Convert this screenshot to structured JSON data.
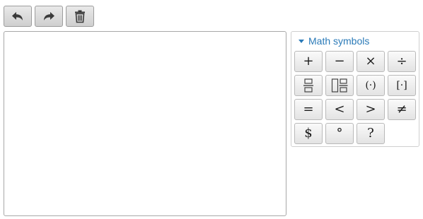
{
  "toolbar": {
    "buttons": [
      {
        "name": "undo-button",
        "icon": "undo-icon"
      },
      {
        "name": "redo-button",
        "icon": "redo-icon"
      },
      {
        "name": "delete-button",
        "icon": "trash-icon"
      }
    ]
  },
  "panel": {
    "title": "Math symbols",
    "symbols": {
      "plus": "+",
      "minus": "−",
      "times": "×",
      "divide": "÷",
      "fraction": "fraction-icon",
      "mixed_number": "mixed-number-icon",
      "parentheses": "(·)",
      "brackets": "[·]",
      "equals": "=",
      "less_than": "<",
      "greater_than": ">",
      "not_equal": "≠",
      "dollar": "$",
      "degree": "°",
      "question": "?"
    }
  },
  "colors": {
    "accent": "#2a7ab8",
    "button_top": "#e9e9e9",
    "button_bottom": "#cfcfcf"
  }
}
